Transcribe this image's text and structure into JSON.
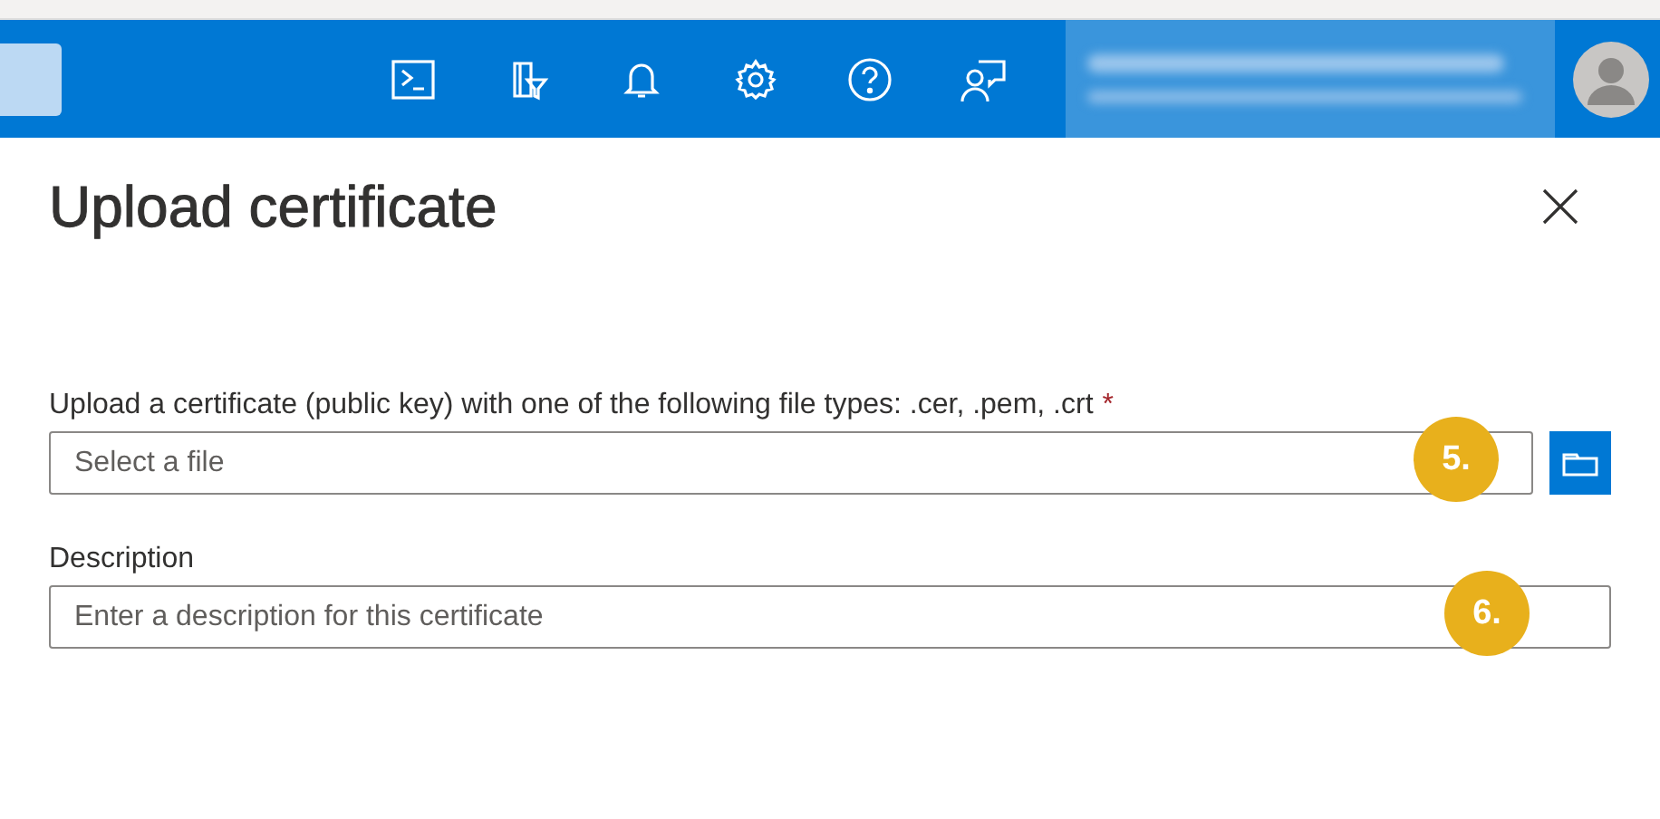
{
  "top_bar": {
    "icons": [
      {
        "kind": "terminal"
      },
      {
        "kind": "filter"
      },
      {
        "kind": "bell"
      },
      {
        "kind": "settings"
      },
      {
        "kind": "help"
      },
      {
        "kind": "feedback"
      }
    ]
  },
  "panel": {
    "title": "Upload certificate",
    "fields": [
      {
        "kind": "file",
        "label": "Upload a certificate (public key) with one of the following file types: .cer, .pem, .crt",
        "required_mark": "*",
        "placeholder": "Select a file",
        "step": "5."
      },
      {
        "kind": "text",
        "label": "Description",
        "placeholder": "Enter a description for this certificate",
        "step": "6."
      }
    ]
  }
}
